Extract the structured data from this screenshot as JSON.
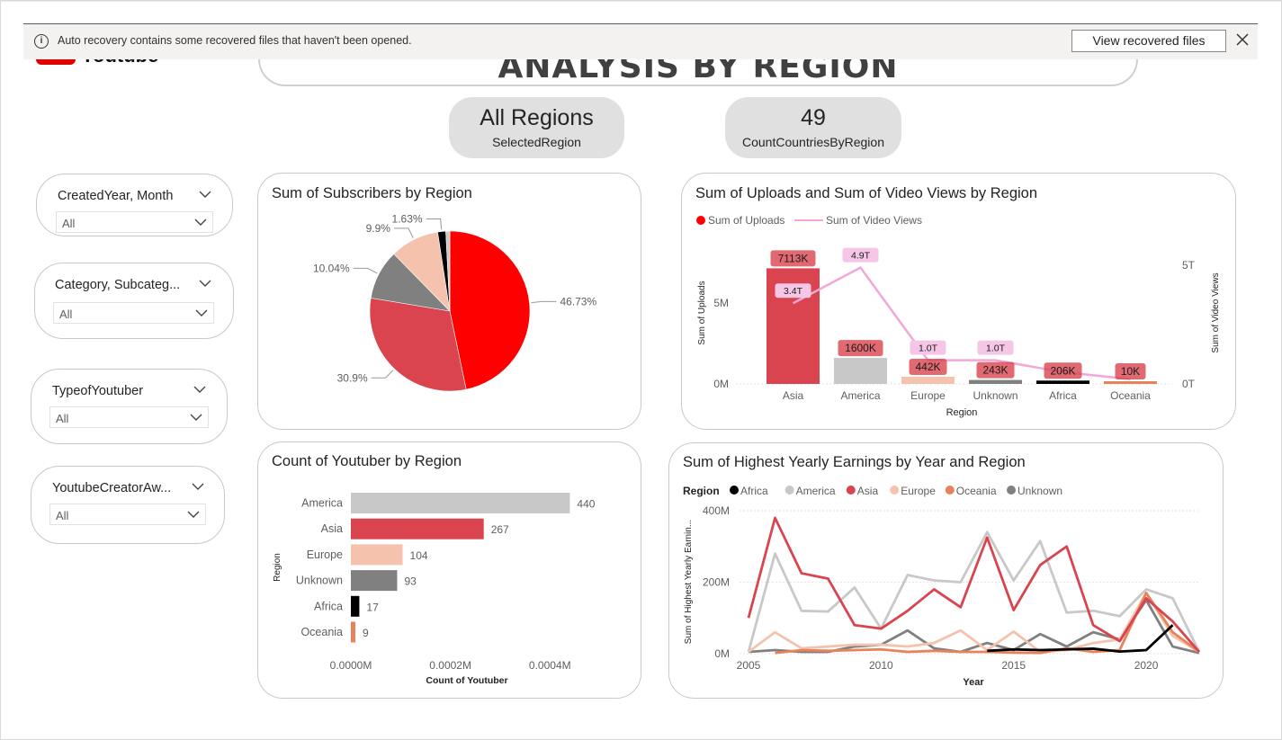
{
  "notification": {
    "message": "Auto recovery contains some recovered files that haven't been opened.",
    "button_label": "View recovered files",
    "info_glyph": "i"
  },
  "logo": {
    "text": "Youtube"
  },
  "page_title": "ANALYSIS BY REGION",
  "kpis": [
    {
      "value": "All Regions",
      "label": "SelectedRegion"
    },
    {
      "value": "49",
      "label": "CountCountriesByRegion"
    }
  ],
  "slicers": [
    {
      "title": "CreatedYear, Month",
      "value": "All"
    },
    {
      "title": "Category, Subcateg...",
      "value": "All"
    },
    {
      "title": "TypeofYoutuber",
      "value": "All"
    },
    {
      "title": "YoutubeCreatorAw...",
      "value": "All"
    }
  ],
  "colors": {
    "Asia": "#d9444f",
    "America": "#c8c8c8",
    "Europe": "#f4c2ad",
    "Unknown": "#808080",
    "Africa": "#000000",
    "Oceania": "#e8825a",
    "pie_asia": "#fe0000",
    "video_views_line": "#f2a7d8"
  },
  "panels": {
    "subscribers": {
      "title": "Sum of Subscribers by Region"
    },
    "uploads": {
      "title": "Sum of Uploads and Sum of Video Views by Region"
    },
    "count": {
      "title": "Count of Youtuber by Region"
    },
    "earnings": {
      "title": "Sum of Highest Yearly Earnings by Year and Region"
    }
  },
  "chart_data": [
    {
      "type": "pie",
      "title": "Sum of Subscribers by Region",
      "categories": [
        "Asia",
        "America",
        "Unknown",
        "Europe",
        "Africa",
        "Oceania"
      ],
      "values": [
        46.73,
        30.9,
        10.04,
        9.9,
        1.63,
        0.8
      ],
      "labels": [
        "46.73%",
        "30.9%",
        "10.04%",
        "9.9%",
        "1.63%",
        ""
      ]
    },
    {
      "type": "bar",
      "title": "Sum of Uploads and Sum of Video Views by Region",
      "legend": [
        "Sum of Uploads",
        "Sum of Video Views"
      ],
      "legend_position": "top-left",
      "categories": [
        "Asia",
        "America",
        "Europe",
        "Unknown",
        "Africa",
        "Oceania"
      ],
      "xlabel": "Region",
      "ylabel": "Sum of Uploads",
      "y2label": "Sum of Video Views",
      "y_ticks": [
        "0M",
        "5M"
      ],
      "y2_ticks": [
        "0T",
        "5T"
      ],
      "ylim": [
        0,
        7300000
      ],
      "y2lim": [
        0,
        5.0
      ],
      "series": [
        {
          "name": "Sum of Uploads",
          "type": "bar",
          "values": [
            7113000,
            1600000,
            442000,
            243000,
            206000,
            10000
          ],
          "data_labels": [
            "7113K",
            "1600K",
            "442K",
            "243K",
            "206K",
            "10K"
          ]
        },
        {
          "name": "Sum of Video Views",
          "type": "line",
          "values": [
            3.4,
            4.9,
            1.0,
            1.0,
            0.5,
            0.2
          ],
          "data_labels": [
            "3.4T",
            "4.9T",
            "1.0T",
            "1.0T",
            "",
            ""
          ]
        }
      ]
    },
    {
      "type": "bar",
      "orientation": "horizontal",
      "title": "Count of Youtuber by Region",
      "categories": [
        "America",
        "Asia",
        "Europe",
        "Unknown",
        "Africa",
        "Oceania"
      ],
      "values": [
        440,
        267,
        104,
        93,
        17,
        9
      ],
      "xlabel": "Count of Youtuber",
      "ylabel": "Region",
      "x_ticks": [
        "0.0000M",
        "0.0002M",
        "0.0004M"
      ],
      "xlim": [
        0,
        470
      ]
    },
    {
      "type": "line",
      "title": "Sum of Highest Yearly Earnings by Year and Region",
      "legend_title": "Region",
      "legend_position": "top-left",
      "xlabel": "Year",
      "ylabel": "Sum of Highest Yearly Earnin...",
      "x_ticks": [
        "2005",
        "2010",
        "2015",
        "2020"
      ],
      "y_ticks": [
        "0M",
        "200M",
        "400M"
      ],
      "xlim": [
        2005,
        2022
      ],
      "ylim": [
        0,
        400
      ],
      "series": [
        {
          "name": "Africa",
          "points": [
            [
              2014,
              8
            ],
            [
              2015,
              12
            ],
            [
              2016,
              10
            ],
            [
              2017,
              12
            ],
            [
              2018,
              14
            ],
            [
              2019,
              6
            ],
            [
              2020,
              10
            ],
            [
              2021,
              80
            ]
          ]
        },
        {
          "name": "America",
          "points": [
            [
              2005,
              5
            ],
            [
              2006,
              280
            ],
            [
              2007,
              120
            ],
            [
              2008,
              118
            ],
            [
              2009,
              185
            ],
            [
              2010,
              70
            ],
            [
              2011,
              220
            ],
            [
              2012,
              205
            ],
            [
              2013,
              200
            ],
            [
              2014,
              340
            ],
            [
              2015,
              205
            ],
            [
              2016,
              315
            ],
            [
              2017,
              115
            ],
            [
              2018,
              120
            ],
            [
              2019,
              105
            ],
            [
              2020,
              180
            ],
            [
              2021,
              155
            ],
            [
              2022,
              5
            ]
          ]
        },
        {
          "name": "Asia",
          "points": [
            [
              2005,
              100
            ],
            [
              2006,
              380
            ],
            [
              2007,
              225
            ],
            [
              2008,
              210
            ],
            [
              2009,
              80
            ],
            [
              2010,
              70
            ],
            [
              2011,
              120
            ],
            [
              2012,
              180
            ],
            [
              2013,
              130
            ],
            [
              2014,
              325
            ],
            [
              2015,
              122
            ],
            [
              2016,
              248
            ],
            [
              2017,
              300
            ],
            [
              2018,
              80
            ],
            [
              2019,
              35
            ],
            [
              2020,
              155
            ],
            [
              2021,
              90
            ],
            [
              2022,
              5
            ]
          ]
        },
        {
          "name": "Europe",
          "points": [
            [
              2005,
              5
            ],
            [
              2006,
              60
            ],
            [
              2007,
              15
            ],
            [
              2008,
              20
            ],
            [
              2009,
              25
            ],
            [
              2010,
              25
            ],
            [
              2011,
              20
            ],
            [
              2012,
              30
            ],
            [
              2013,
              65
            ],
            [
              2014,
              10
            ],
            [
              2015,
              62
            ],
            [
              2016,
              5
            ],
            [
              2017,
              10
            ],
            [
              2018,
              30
            ],
            [
              2019,
              40
            ],
            [
              2020,
              170
            ],
            [
              2021,
              50
            ],
            [
              2022,
              5
            ]
          ]
        },
        {
          "name": "Oceania",
          "points": [
            [
              2006,
              2
            ],
            [
              2007,
              10
            ],
            [
              2008,
              8
            ],
            [
              2009,
              10
            ],
            [
              2010,
              12
            ],
            [
              2011,
              5
            ],
            [
              2012,
              8
            ],
            [
              2013,
              5
            ],
            [
              2014,
              5
            ],
            [
              2015,
              3
            ],
            [
              2016,
              2
            ],
            [
              2017,
              15
            ],
            [
              2018,
              5
            ],
            [
              2019,
              10
            ],
            [
              2020,
              170
            ],
            [
              2021,
              60
            ],
            [
              2022,
              5
            ]
          ]
        },
        {
          "name": "Unknown",
          "points": [
            [
              2005,
              5
            ],
            [
              2006,
              10
            ],
            [
              2007,
              5
            ],
            [
              2008,
              5
            ],
            [
              2009,
              20
            ],
            [
              2010,
              25
            ],
            [
              2011,
              65
            ],
            [
              2012,
              15
            ],
            [
              2013,
              5
            ],
            [
              2014,
              30
            ],
            [
              2015,
              10
            ],
            [
              2016,
              55
            ],
            [
              2017,
              20
            ],
            [
              2018,
              60
            ],
            [
              2019,
              40
            ],
            [
              2020,
              150
            ],
            [
              2021,
              20
            ],
            [
              2022,
              2
            ]
          ]
        }
      ]
    }
  ]
}
